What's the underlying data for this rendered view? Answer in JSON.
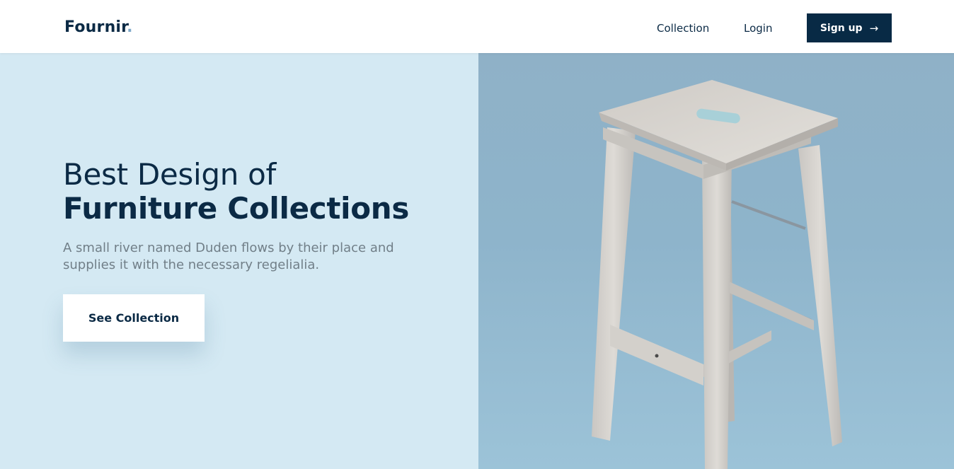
{
  "brand": {
    "name": "Fournir",
    "dot": "."
  },
  "nav": {
    "links": [
      {
        "label": "Collection"
      },
      {
        "label": "Login"
      }
    ],
    "signup_label": "Sign up",
    "signup_icon": "arrow-right-icon"
  },
  "hero": {
    "title_line1": "Best Design of",
    "title_line2": "Furniture Collections",
    "subtitle": "A small river named Duden flows by their place and supplies it with the necessary regelialia.",
    "cta_label": "See Collection",
    "image": "wooden-stool-photo"
  },
  "colors": {
    "primary": "#082a45",
    "hero_left_bg": "#d4e9f3",
    "hero_right_bg": "#8eb4cb",
    "subtitle_text": "#717f88"
  }
}
